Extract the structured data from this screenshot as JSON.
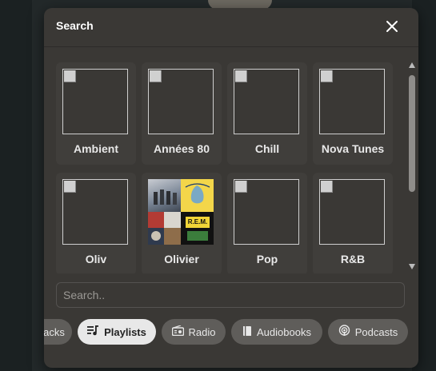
{
  "dialog": {
    "title": "Search",
    "close_icon": "close-icon"
  },
  "playlists": [
    {
      "label": "Ambient",
      "thumb": "broken-image"
    },
    {
      "label": "Années 80",
      "thumb": "broken-image"
    },
    {
      "label": "Chill",
      "thumb": "broken-image"
    },
    {
      "label": "Nova Tunes",
      "thumb": "broken-image"
    },
    {
      "label": "Oliv",
      "thumb": "broken-image"
    },
    {
      "label": "Olivier",
      "thumb": "album-collage"
    },
    {
      "label": "Pop",
      "thumb": "broken-image"
    },
    {
      "label": "R&B",
      "thumb": "broken-image"
    }
  ],
  "collage": {
    "cover_2_text": "R.E.M."
  },
  "search": {
    "placeholder": "Search.."
  },
  "filters": [
    {
      "label": "acks",
      "icon": "none",
      "active": false
    },
    {
      "label": "Playlists",
      "icon": "playlist-icon",
      "active": true
    },
    {
      "label": "Radio",
      "icon": "radio-icon",
      "active": false
    },
    {
      "label": "Audiobooks",
      "icon": "book-icon",
      "active": false
    },
    {
      "label": "Podcasts",
      "icon": "podcast-icon",
      "active": false
    }
  ],
  "colors": {
    "dialog_bg": "#3a3835",
    "card_bg": "#403e3b",
    "chip_bg": "#5f5d5a",
    "chip_active_bg": "#e8e8e8"
  }
}
